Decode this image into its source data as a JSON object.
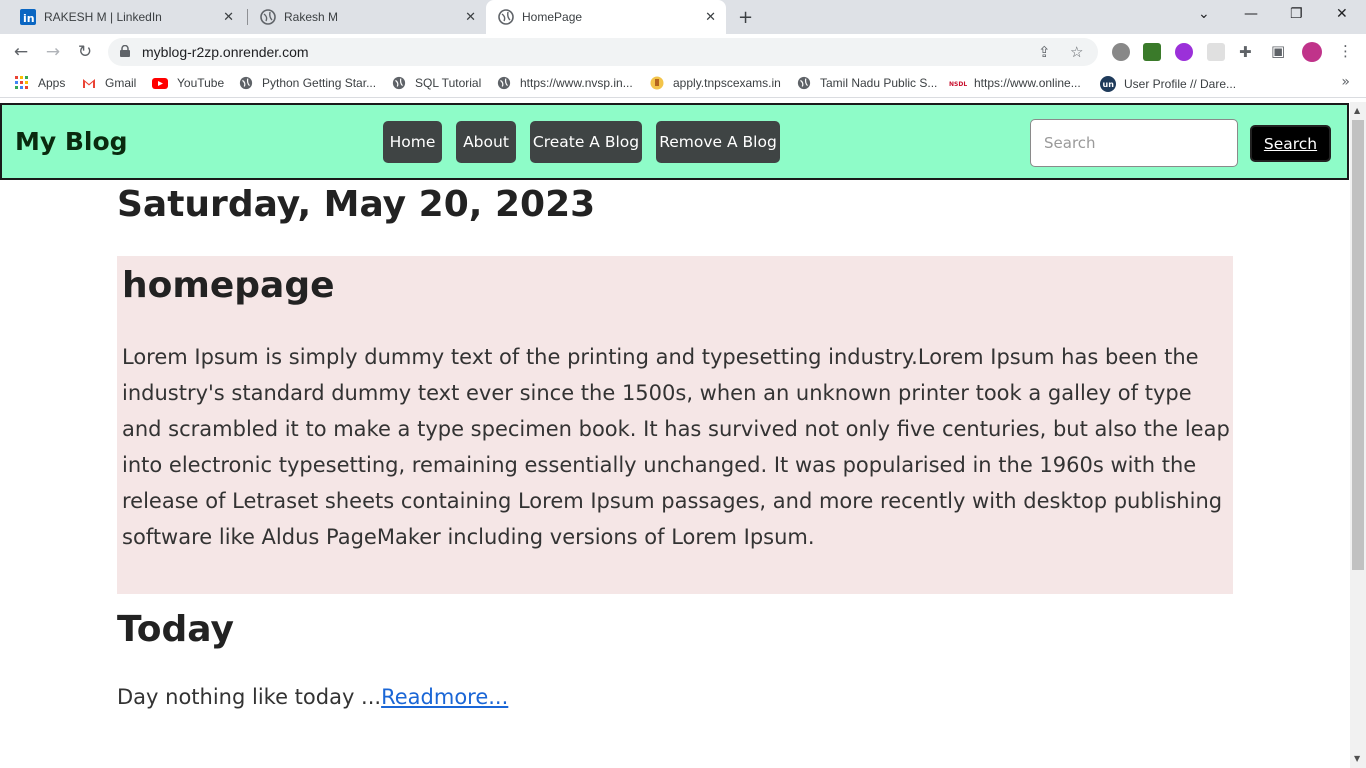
{
  "browser": {
    "tabs": [
      {
        "title": "RAKESH M | LinkedIn",
        "icon": "linkedin-icon",
        "active": false
      },
      {
        "title": "Rakesh M",
        "icon": "globe-icon",
        "active": false
      },
      {
        "title": "HomePage",
        "icon": "globe-icon",
        "active": true
      }
    ],
    "new_tab": "+",
    "window_controls": {
      "dropdown": "⌄",
      "minimize": "—",
      "restore": "❐",
      "close": "✕"
    },
    "url": "myblog-r2zp.onrender.com",
    "bookmarks": [
      {
        "label": "Apps",
        "icon": "apps-grid-icon"
      },
      {
        "label": "Gmail",
        "icon": "gmail-icon"
      },
      {
        "label": "YouTube",
        "icon": "youtube-icon"
      },
      {
        "label": "Python Getting Star...",
        "icon": "globe-icon"
      },
      {
        "label": "SQL Tutorial",
        "icon": "globe-icon"
      },
      {
        "label": "https://www.nvsp.in...",
        "icon": "globe-icon"
      },
      {
        "label": "apply.tnpscexams.in",
        "icon": "tn-emblem-icon"
      },
      {
        "label": "Tamil Nadu Public S...",
        "icon": "globe-icon"
      },
      {
        "label": "https://www.online...",
        "icon": "nsdl-icon"
      },
      {
        "label": "User Profile // Dare...",
        "icon": "un-icon"
      }
    ],
    "bookmarks_more": "»"
  },
  "site": {
    "brand": "My Blog",
    "nav": [
      "Home",
      "About",
      "Create A Blog",
      "Remove A Blog"
    ],
    "search_placeholder": "Search",
    "search_button": "Search",
    "colors": {
      "navbar_bg": "#8efcc8",
      "button_bg": "#3f4444",
      "featured_bg": "#f5e6e6",
      "link": "#1a66d6"
    }
  },
  "content": {
    "date": "Saturday, May 20, 2023",
    "featured": {
      "title": "homepage",
      "body": "Lorem Ipsum is simply dummy text of the printing and typesetting industry.Lorem Ipsum has been the industry's standard dummy text ever since the 1500s, when an unknown printer took a galley of type and scrambled it to make a type specimen book. It has survived not only five centuries, but also the leap into electronic typesetting, remaining essentially unchanged. It was popularised in the 1960s with the release of Letraset sheets containing Lorem Ipsum passages, and more recently with desktop publishing software like Aldus PageMaker including versions of Lorem Ipsum."
    },
    "posts": [
      {
        "title": "Today",
        "excerpt": "Day nothing like today ...",
        "readmore": "Readmore..."
      }
    ]
  }
}
